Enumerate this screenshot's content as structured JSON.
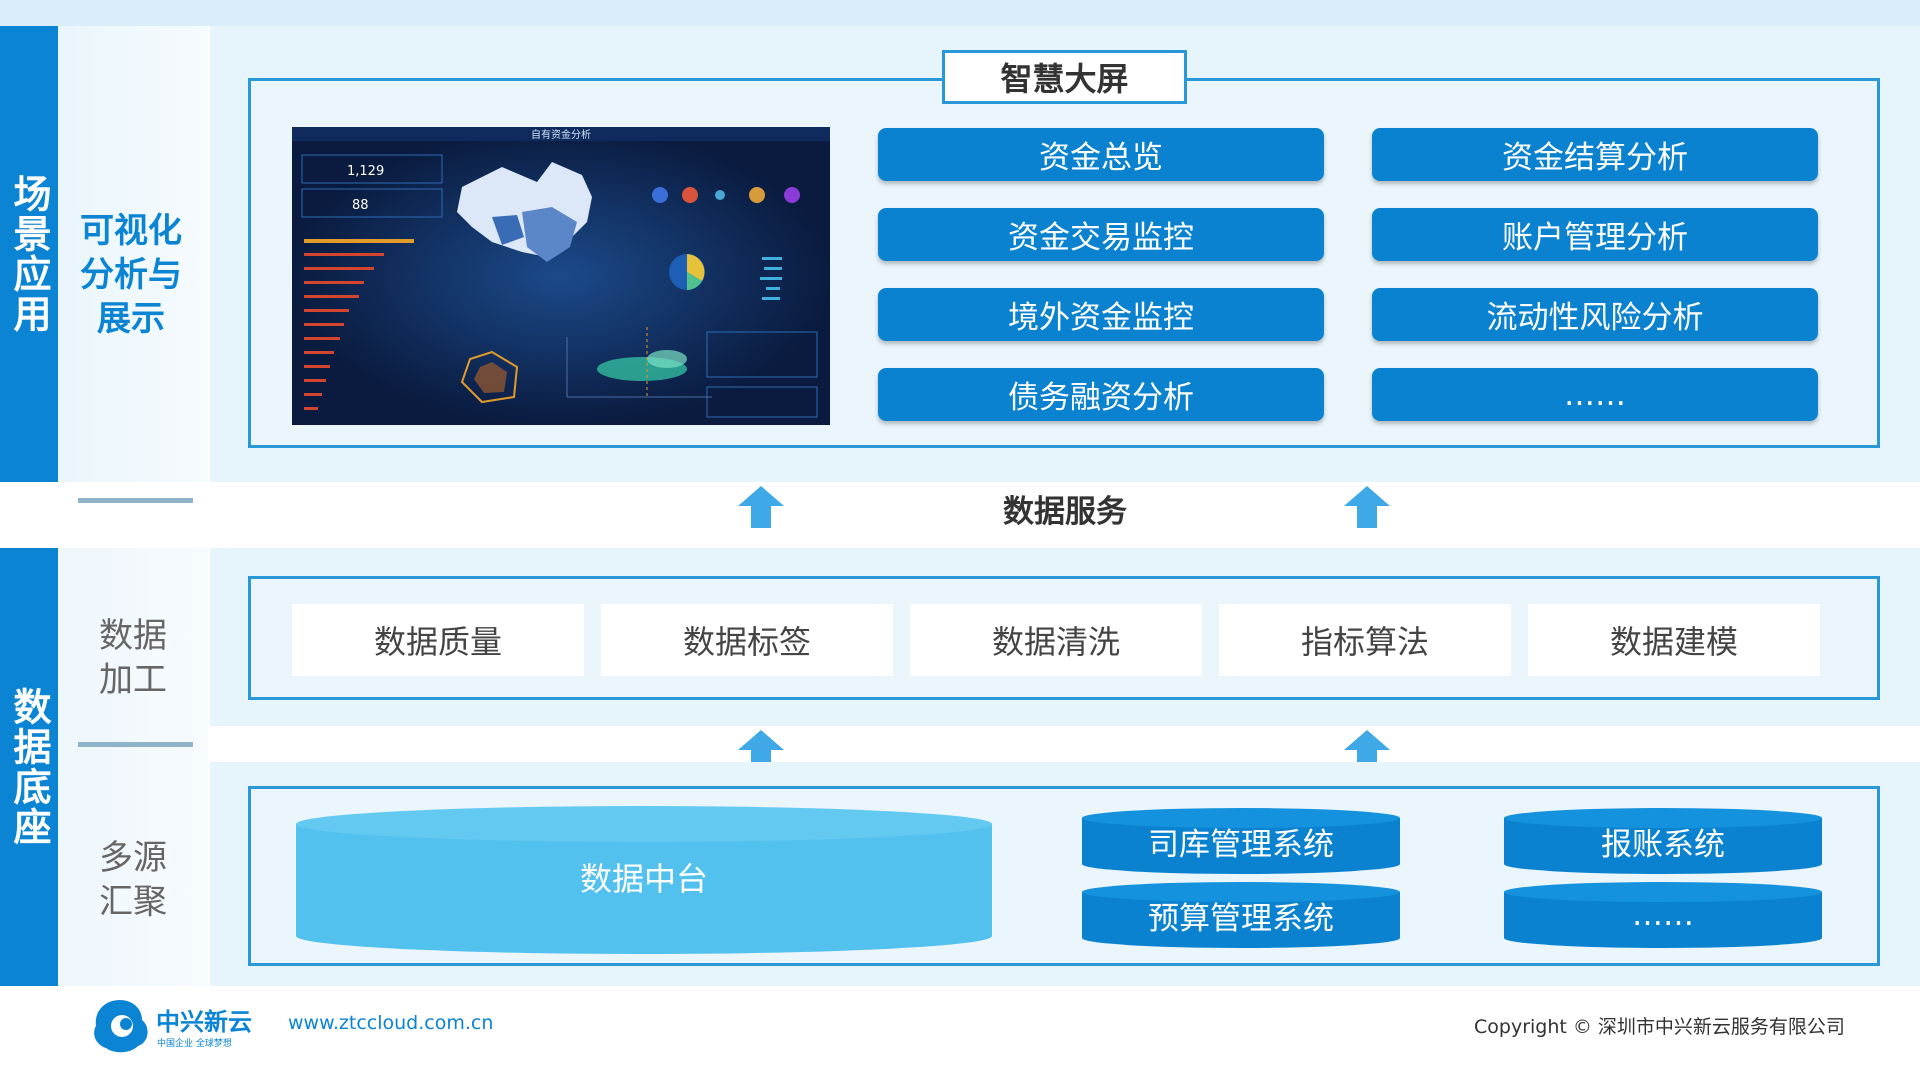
{
  "sections": {
    "scene": {
      "label": "场景应用",
      "sub": "可视化分析与展示"
    },
    "base": {
      "label": "数据底座",
      "sub_process": "数据加工",
      "sub_source": "多源汇聚"
    }
  },
  "smart_screen": {
    "title": "智慧大屏",
    "dashboard": {
      "title": "自有资金分析",
      "metric1": "1,129",
      "metric2": "88"
    },
    "items": [
      "资金总览",
      "资金结算分析",
      "资金交易监控",
      "账户管理分析",
      "境外资金监控",
      "流动性风险分析",
      "债务融资分析",
      "……"
    ]
  },
  "data_service": "数据服务",
  "processing": [
    "数据质量",
    "数据标签",
    "数据清洗",
    "指标算法",
    "数据建模"
  ],
  "sources": {
    "platform": "数据中台",
    "systems": [
      "司库管理系统",
      "报账系统",
      "预算管理系统",
      "……"
    ]
  },
  "footer": {
    "brand": "中兴新云",
    "slogan": "中国企业 全球梦想",
    "url": "www.ztccloud.com.cn",
    "copyright": "Copyright © 深圳市中兴新云服务有限公司"
  },
  "colors": {
    "primary": "#0b84d4",
    "frame": "#2a97d8",
    "panel": "#e6f4fb",
    "cylinder": "#52c1ee",
    "arrow": "#3fa9e8"
  }
}
